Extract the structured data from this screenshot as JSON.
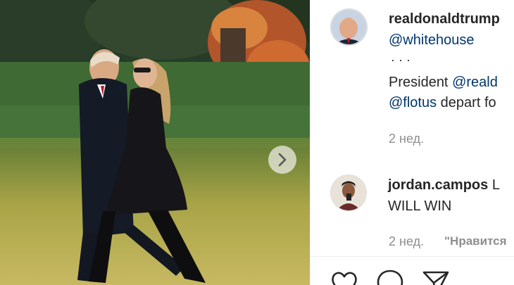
{
  "post": {
    "author": "realdonaldtrump",
    "tagged_account": "@whitehouse",
    "ellipsis": "·   ·   ·",
    "caption_word": "President",
    "caption_mention": "@reald",
    "caption_mention2": "@flotus",
    "caption_rest": "depart fo",
    "time_ago": "2 нед."
  },
  "comments": [
    {
      "username": "jordan.campos",
      "text_inline": "L",
      "text_line2": "WILL WIN",
      "time_ago": "2 нед.",
      "like_label": "\"Нравится"
    }
  ],
  "icons": {
    "next": "chevron-right-icon",
    "like": "heart-icon",
    "comment": "comment-icon",
    "share": "paper-plane-icon"
  },
  "colors": {
    "link": "#00376b",
    "text": "#262626",
    "muted": "#8e8e8e"
  }
}
